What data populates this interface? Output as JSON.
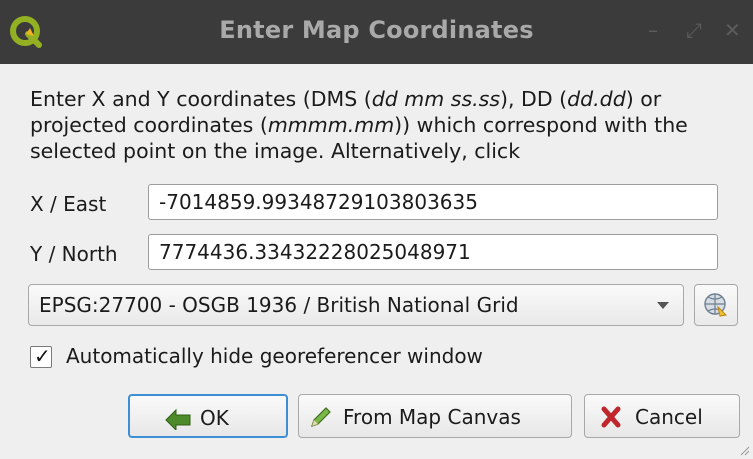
{
  "window": {
    "title": "Enter Map Coordinates",
    "minimize_glyph": "–",
    "restore_glyph": "⤢",
    "close_glyph": "✕"
  },
  "description": {
    "p1": "Enter X and Y coordinates (DMS (",
    "i1": "dd mm ss.ss",
    "p2": "), DD (",
    "i2": "dd.dd",
    "p3": ") or projected coordinates (",
    "i3": "mmmm.mm",
    "p4": ")) which correspond with the selected point on the image. Alternatively, click"
  },
  "x_field": {
    "label": "X / East",
    "value": "-7014859.99348729103803635"
  },
  "y_field": {
    "label": "Y / North",
    "value": "7774436.33432228025048971"
  },
  "crs": {
    "selected": "EPSG:27700 - OSGB 1936 / British National Grid",
    "icon": "crs-selector-icon"
  },
  "auto_hide": {
    "label": "Automatically hide georeferencer window",
    "checked": true,
    "mark": "✓"
  },
  "buttons": {
    "ok": "OK",
    "from_map": "From Map Canvas",
    "cancel": "Cancel"
  },
  "colors": {
    "titlebar": "#3b3b3b",
    "focus": "#3e8ed6",
    "qgis_green": "#93b023"
  }
}
